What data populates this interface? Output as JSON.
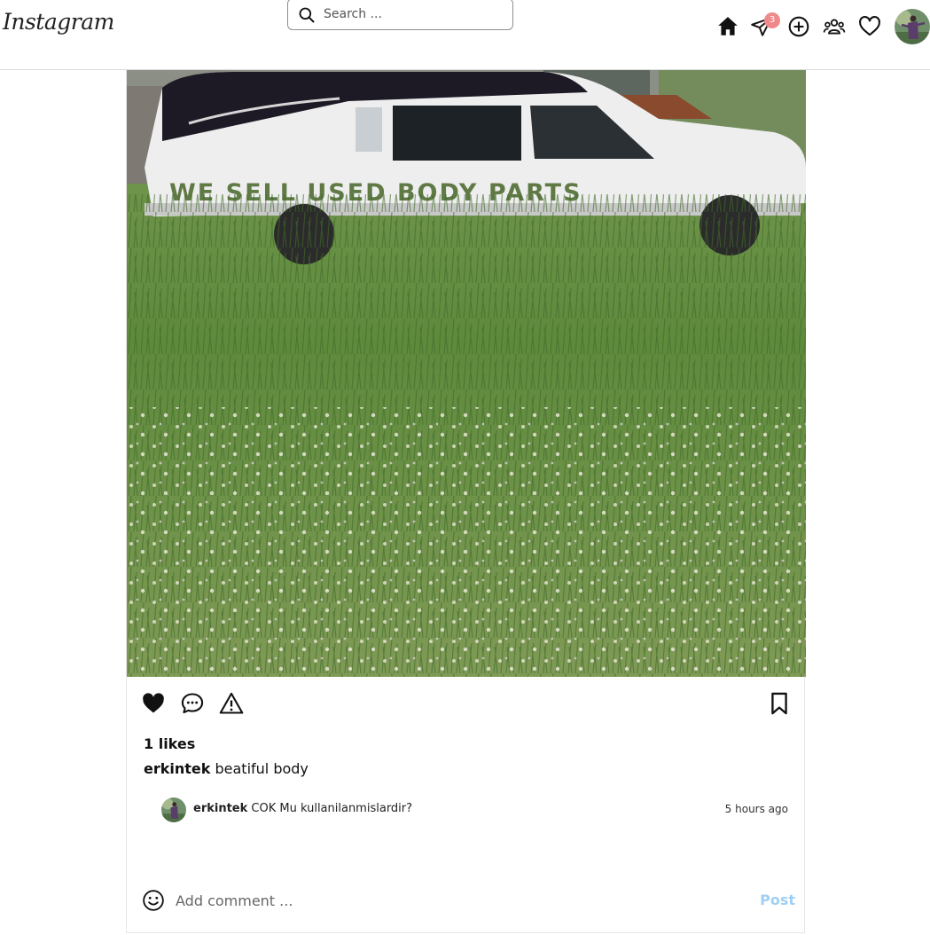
{
  "header": {
    "logo": "Instagram",
    "search_placeholder": "Search ...",
    "notification_count": "3",
    "icons": [
      "home-icon",
      "send-icon",
      "add-post-icon",
      "people-icon",
      "heart-icon"
    ]
  },
  "post": {
    "image_text": "WE SELL USED BODY PARTS",
    "likes": "1 likes",
    "author": "erkintek",
    "caption": "beatiful body",
    "comments": [
      {
        "user": "erkintek",
        "text": "COK Mu kullanilanmislardir?",
        "time": "5 hours ago"
      }
    ],
    "add_comment_placeholder": "Add comment ...",
    "post_label": "Post"
  },
  "colors": {
    "like_red": "#000000",
    "post_button": "#9fcff5",
    "badge": "#f08a8a"
  }
}
